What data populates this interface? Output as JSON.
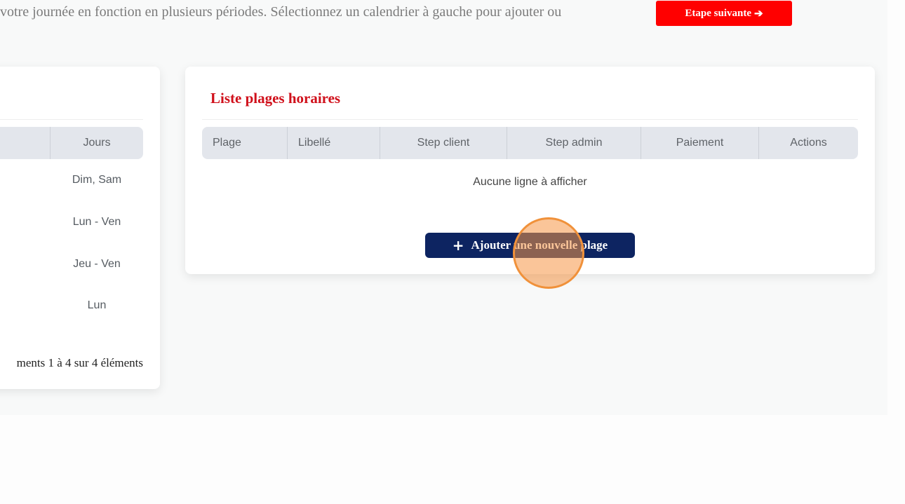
{
  "header": {
    "intro_text": "votre journée en fonction en plusieurs périodes. Sélectionnez un calendrier à gauche pour ajouter ou",
    "next_button_label": "Etape suivante",
    "next_button_icon": "arrow-right-icon"
  },
  "calendar_list": {
    "columns": [
      "Jours"
    ],
    "rows": [
      {
        "jours": "Dim, Sam"
      },
      {
        "jours": "Lun - Ven"
      },
      {
        "jours": "Jeu - Ven"
      },
      {
        "jours": "Lun"
      }
    ],
    "footer": "ments 1 à 4 sur 4 éléments"
  },
  "time_slots": {
    "title": "Liste plages horaires",
    "columns": [
      "Plage",
      "Libellé",
      "Step client",
      "Step admin",
      "Paiement",
      "Actions"
    ],
    "empty_message": "Aucune ligne à afficher",
    "add_button_label": "Ajouter une nouvelle plage",
    "add_button_icon": "plus-icon"
  },
  "colors": {
    "accent_red": "#ff0000",
    "title_red": "#d0101b",
    "primary_navy": "#0d2461",
    "header_gray": "#e3e6ec",
    "click_marker": "#f0913a"
  }
}
